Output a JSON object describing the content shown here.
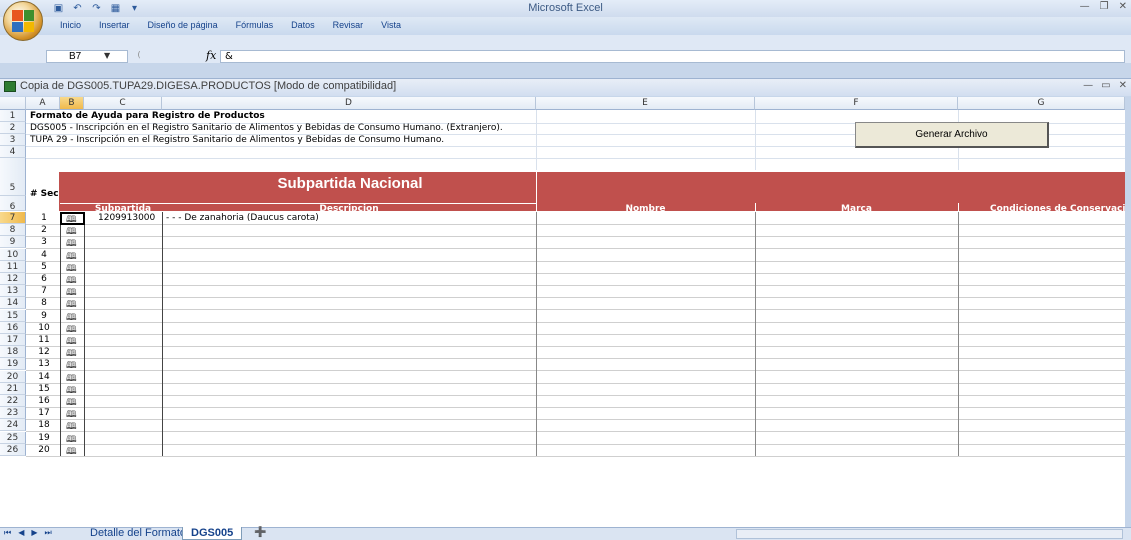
{
  "app": {
    "title": "Microsoft Excel",
    "ribbon_tabs": [
      "Inicio",
      "Insertar",
      "Diseño de página",
      "Fórmulas",
      "Datos",
      "Revisar",
      "Vista"
    ]
  },
  "formula_bar": {
    "name_box": "B7",
    "formula": "&"
  },
  "workbook": {
    "title": "Copia de DGS005.TUPA29.DIGESA.PRODUCTOS  [Modo de compatibilidad]"
  },
  "columns": [
    "A",
    "B",
    "C",
    "D",
    "E",
    "F",
    "G"
  ],
  "rows": [
    "1",
    "2",
    "3",
    "4",
    "5",
    "6",
    "7",
    "8",
    "9",
    "10",
    "11",
    "12",
    "13",
    "14",
    "15",
    "16",
    "17",
    "18",
    "19",
    "20",
    "21",
    "22",
    "23",
    "24",
    "25",
    "26"
  ],
  "sheet": {
    "line1": "Formato de Ayuda para Registro de Productos",
    "line2": "DGS005 - Inscripción en el Registro Sanitario de Alimentos y Bebidas de Consumo Humano. (Extranjero).",
    "line3": "TUPA 29 - Inscripción en el Registro Sanitario de Alimentos y Bebidas de Consumo Humano.",
    "sec_header": "# Sec",
    "banner": "Subpartida Nacional",
    "headers": {
      "subpartida": "Subpartida",
      "descripcion": "Descripcion",
      "nombre": "Nombre",
      "marca": "Marca",
      "condiciones": "Condiciones de Conservacion"
    },
    "first_row": {
      "subpartida": "1209913000",
      "descripcion": "- - - De zanahoria (Daucus carota)"
    },
    "seq": [
      "1",
      "2",
      "3",
      "4",
      "5",
      "6",
      "7",
      "8",
      "9",
      "10",
      "11",
      "12",
      "13",
      "14",
      "15",
      "16",
      "17",
      "18",
      "19",
      "20"
    ],
    "generate_button": "Generar Archivo"
  },
  "sheet_tabs": [
    "Detalle del Formato",
    "DGS005"
  ],
  "active_sheet": "DGS005",
  "colors": {
    "header_red": "#c0504d",
    "selection_orange": "#f0b94c"
  }
}
